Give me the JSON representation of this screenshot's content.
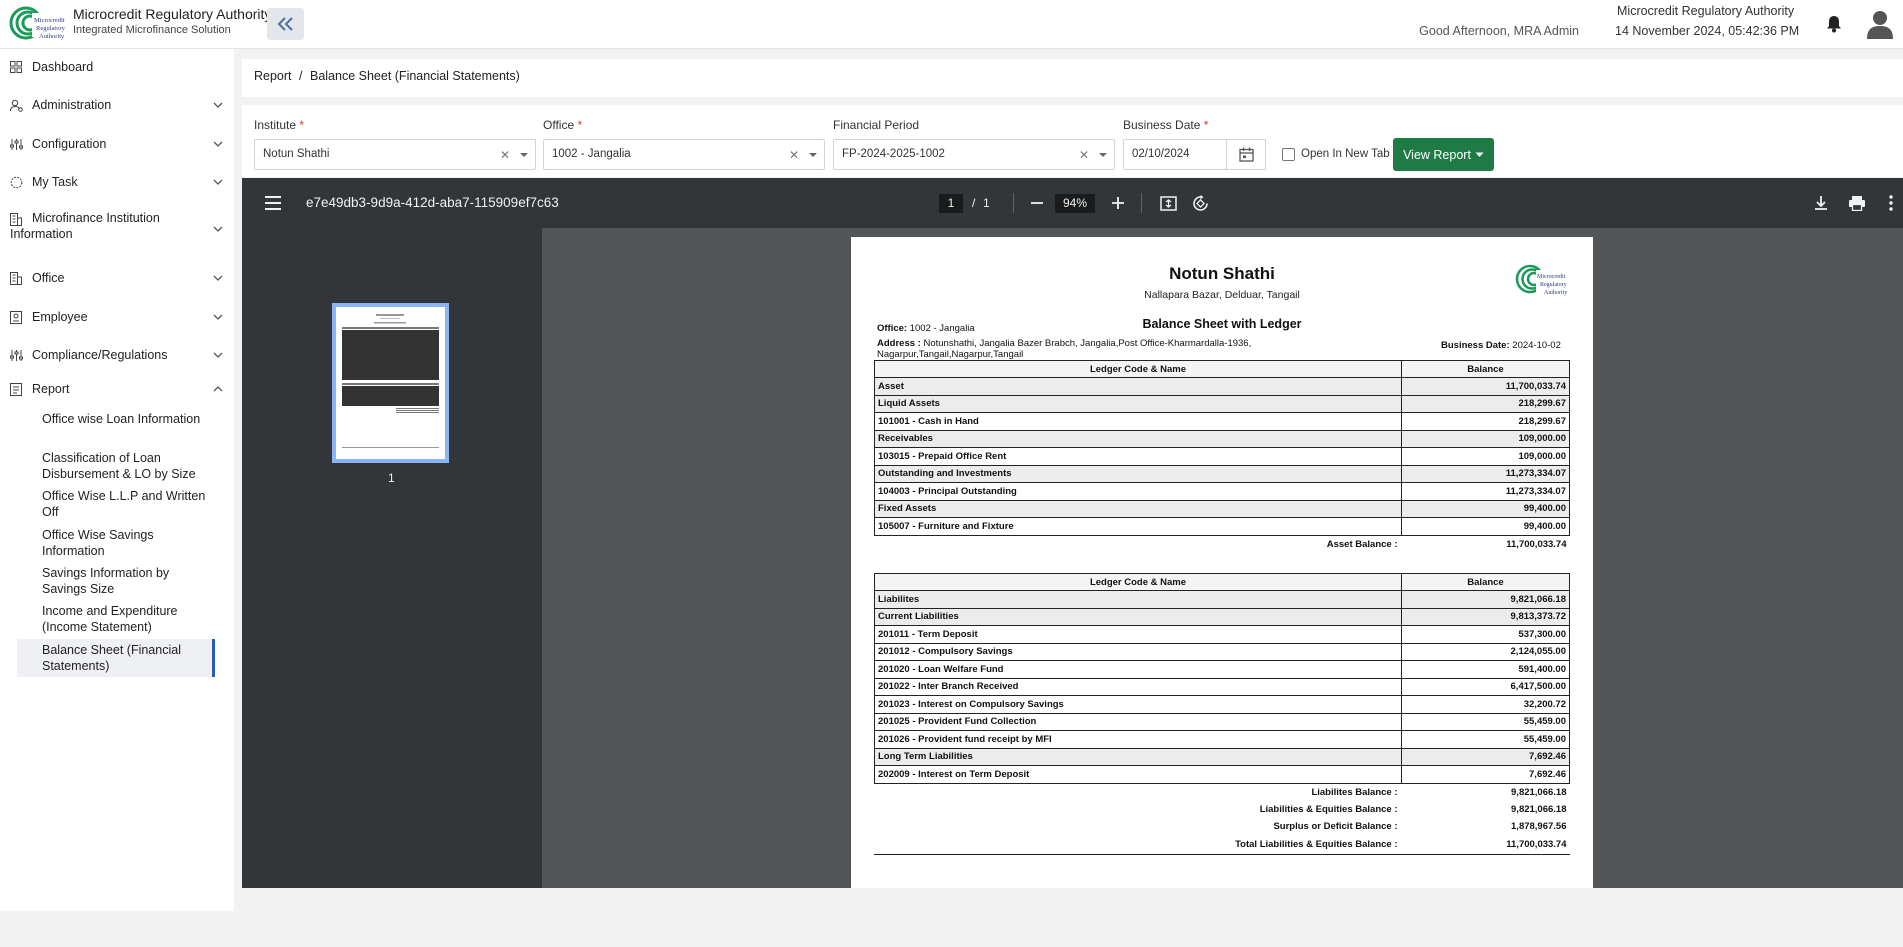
{
  "header": {
    "brand_title": "Microcredit Regulatory Authority",
    "brand_subtitle": "Integrated Microfinance Solution",
    "logo_text": "Microcredit Regulatory Authority",
    "greeting": "Good Afternoon, MRA Admin",
    "org_name": "Microcredit Regulatory Authority",
    "datetime": "14 November 2024, 05:42:36 PM"
  },
  "sidebar": {
    "items": [
      {
        "label": "Dashboard",
        "icon": "grid-icon"
      },
      {
        "label": "Administration",
        "icon": "users-cog-icon"
      },
      {
        "label": "Configuration",
        "icon": "sliders-icon"
      },
      {
        "label": "My Task",
        "icon": "circle-icon"
      },
      {
        "label": "Microfinance Institution Information",
        "icon": "building-icon"
      },
      {
        "label": "Office",
        "icon": "building-icon"
      },
      {
        "label": "Employee",
        "icon": "id-card-icon"
      },
      {
        "label": "Compliance/Regulations",
        "icon": "sliders-icon"
      },
      {
        "label": "Report",
        "icon": "report-icon"
      }
    ],
    "report_sub": [
      "Office wise Loan Information",
      "Classification of Loan Disbursement & LO by Size",
      "Office Wise L.L.P and Written Off",
      "Office Wise Savings Information",
      "Savings Information by Savings Size",
      "Income and Expenditure (Income Statement)",
      "Balance Sheet (Financial Statements)"
    ]
  },
  "breadcrumb": {
    "root": "Report",
    "sep": "/",
    "current": "Balance Sheet (Financial Statements)"
  },
  "filters": {
    "institute_label": "Institute",
    "institute_value": "Notun Shathi",
    "office_label": "Office",
    "office_value": "1002 - Jangalia",
    "period_label": "Financial Period",
    "period_value": "FP-2024-2025-1002",
    "date_label": "Business Date",
    "date_value": "02/10/2024",
    "required_mark": "*",
    "open_new_tab_label": "Open In New Tab",
    "view_report_label": "View Report"
  },
  "viewer": {
    "doc_title": "e7e49db3-9d9a-412d-aba7-115909ef7c63",
    "page_current": "1",
    "page_sep": "/",
    "page_total": "1",
    "zoom": "94%",
    "thumb_label": "1"
  },
  "report": {
    "org": "Notun Shathi",
    "address_line": "Nallapara Bazar, Delduar, Tangail",
    "subtitle": "Balance Sheet with Ledger",
    "office_label": "Office:",
    "office_value": "1002 - Jangalia",
    "address_label": "Address :",
    "address_value": "Notunshathi, Jangalia Bazer Brabch, Jangalia,Post Office-Kharmardalla-1936,",
    "address_value2": "Nagarpur,Tangail,Nagarpur,Tangail",
    "bdate_label": "Business Date:",
    "bdate_value": "2024-10-02",
    "col_name": "Ledger Code & Name",
    "col_balance": "Balance",
    "assets": [
      {
        "level": 0,
        "name": "Asset",
        "balance": "11,700,033.74"
      },
      {
        "level": 1,
        "name": "Liquid Assets",
        "balance": "218,299.67"
      },
      {
        "level": 2,
        "name": "101001 - Cash in Hand",
        "balance": "218,299.67"
      },
      {
        "level": 1,
        "name": "Receivables",
        "balance": "109,000.00"
      },
      {
        "level": 2,
        "name": "103015 - Prepaid Office Rent",
        "balance": "109,000.00"
      },
      {
        "level": 1,
        "name": "Outstanding and Investments",
        "balance": "11,273,334.07"
      },
      {
        "level": 2,
        "name": "104003 - Principal Outstanding",
        "balance": "11,273,334.07"
      },
      {
        "level": 1,
        "name": "Fixed Assets",
        "balance": "99,400.00"
      },
      {
        "level": 2,
        "name": "105007 - Furniture and Fixture",
        "balance": "99,400.00"
      }
    ],
    "asset_total": {
      "label": "Asset Balance :",
      "value": "11,700,033.74"
    },
    "liabilities": [
      {
        "level": 0,
        "name": "Liabilites",
        "balance": "9,821,066.18"
      },
      {
        "level": 1,
        "name": "Current Liabilities",
        "balance": "9,813,373.72"
      },
      {
        "level": 2,
        "name": "201011 - Term Deposit",
        "balance": "537,300.00"
      },
      {
        "level": 2,
        "name": "201012 - Compulsory Savings",
        "balance": "2,124,055.00"
      },
      {
        "level": 2,
        "name": "201020 - Loan Welfare Fund",
        "balance": "591,400.00"
      },
      {
        "level": 2,
        "name": "201022 - Inter Branch Received",
        "balance": "6,417,500.00"
      },
      {
        "level": 2,
        "name": "201023 - Interest on Compulsory Savings",
        "balance": "32,200.72"
      },
      {
        "level": 2,
        "name": "201025 - Provident Fund Collection",
        "balance": "55,459.00"
      },
      {
        "level": 2,
        "name": "201026 - Provident fund receipt by MFI",
        "balance": "55,459.00"
      },
      {
        "level": 1,
        "name": "Long Term Liabilities",
        "balance": "7,692.46"
      },
      {
        "level": 2,
        "name": "202009 - Interest on Term Deposit",
        "balance": "7,692.46"
      }
    ],
    "liab_totals": [
      {
        "label": "Liabilites Balance :",
        "value": "9,821,066.18"
      },
      {
        "label": "Liabilities & Equities Balance :",
        "value": "9,821,066.18"
      },
      {
        "label": "Surplus or Deficit Balance :",
        "value": "1,878,967.56"
      },
      {
        "label": "Total Liabilities & Equities Balance :",
        "value": "11,700,033.74"
      }
    ]
  },
  "colors": {
    "accent": "#1e7b46",
    "active": "#2a5db0",
    "viewer_bg": "#525659",
    "toolbar": "#323639"
  }
}
